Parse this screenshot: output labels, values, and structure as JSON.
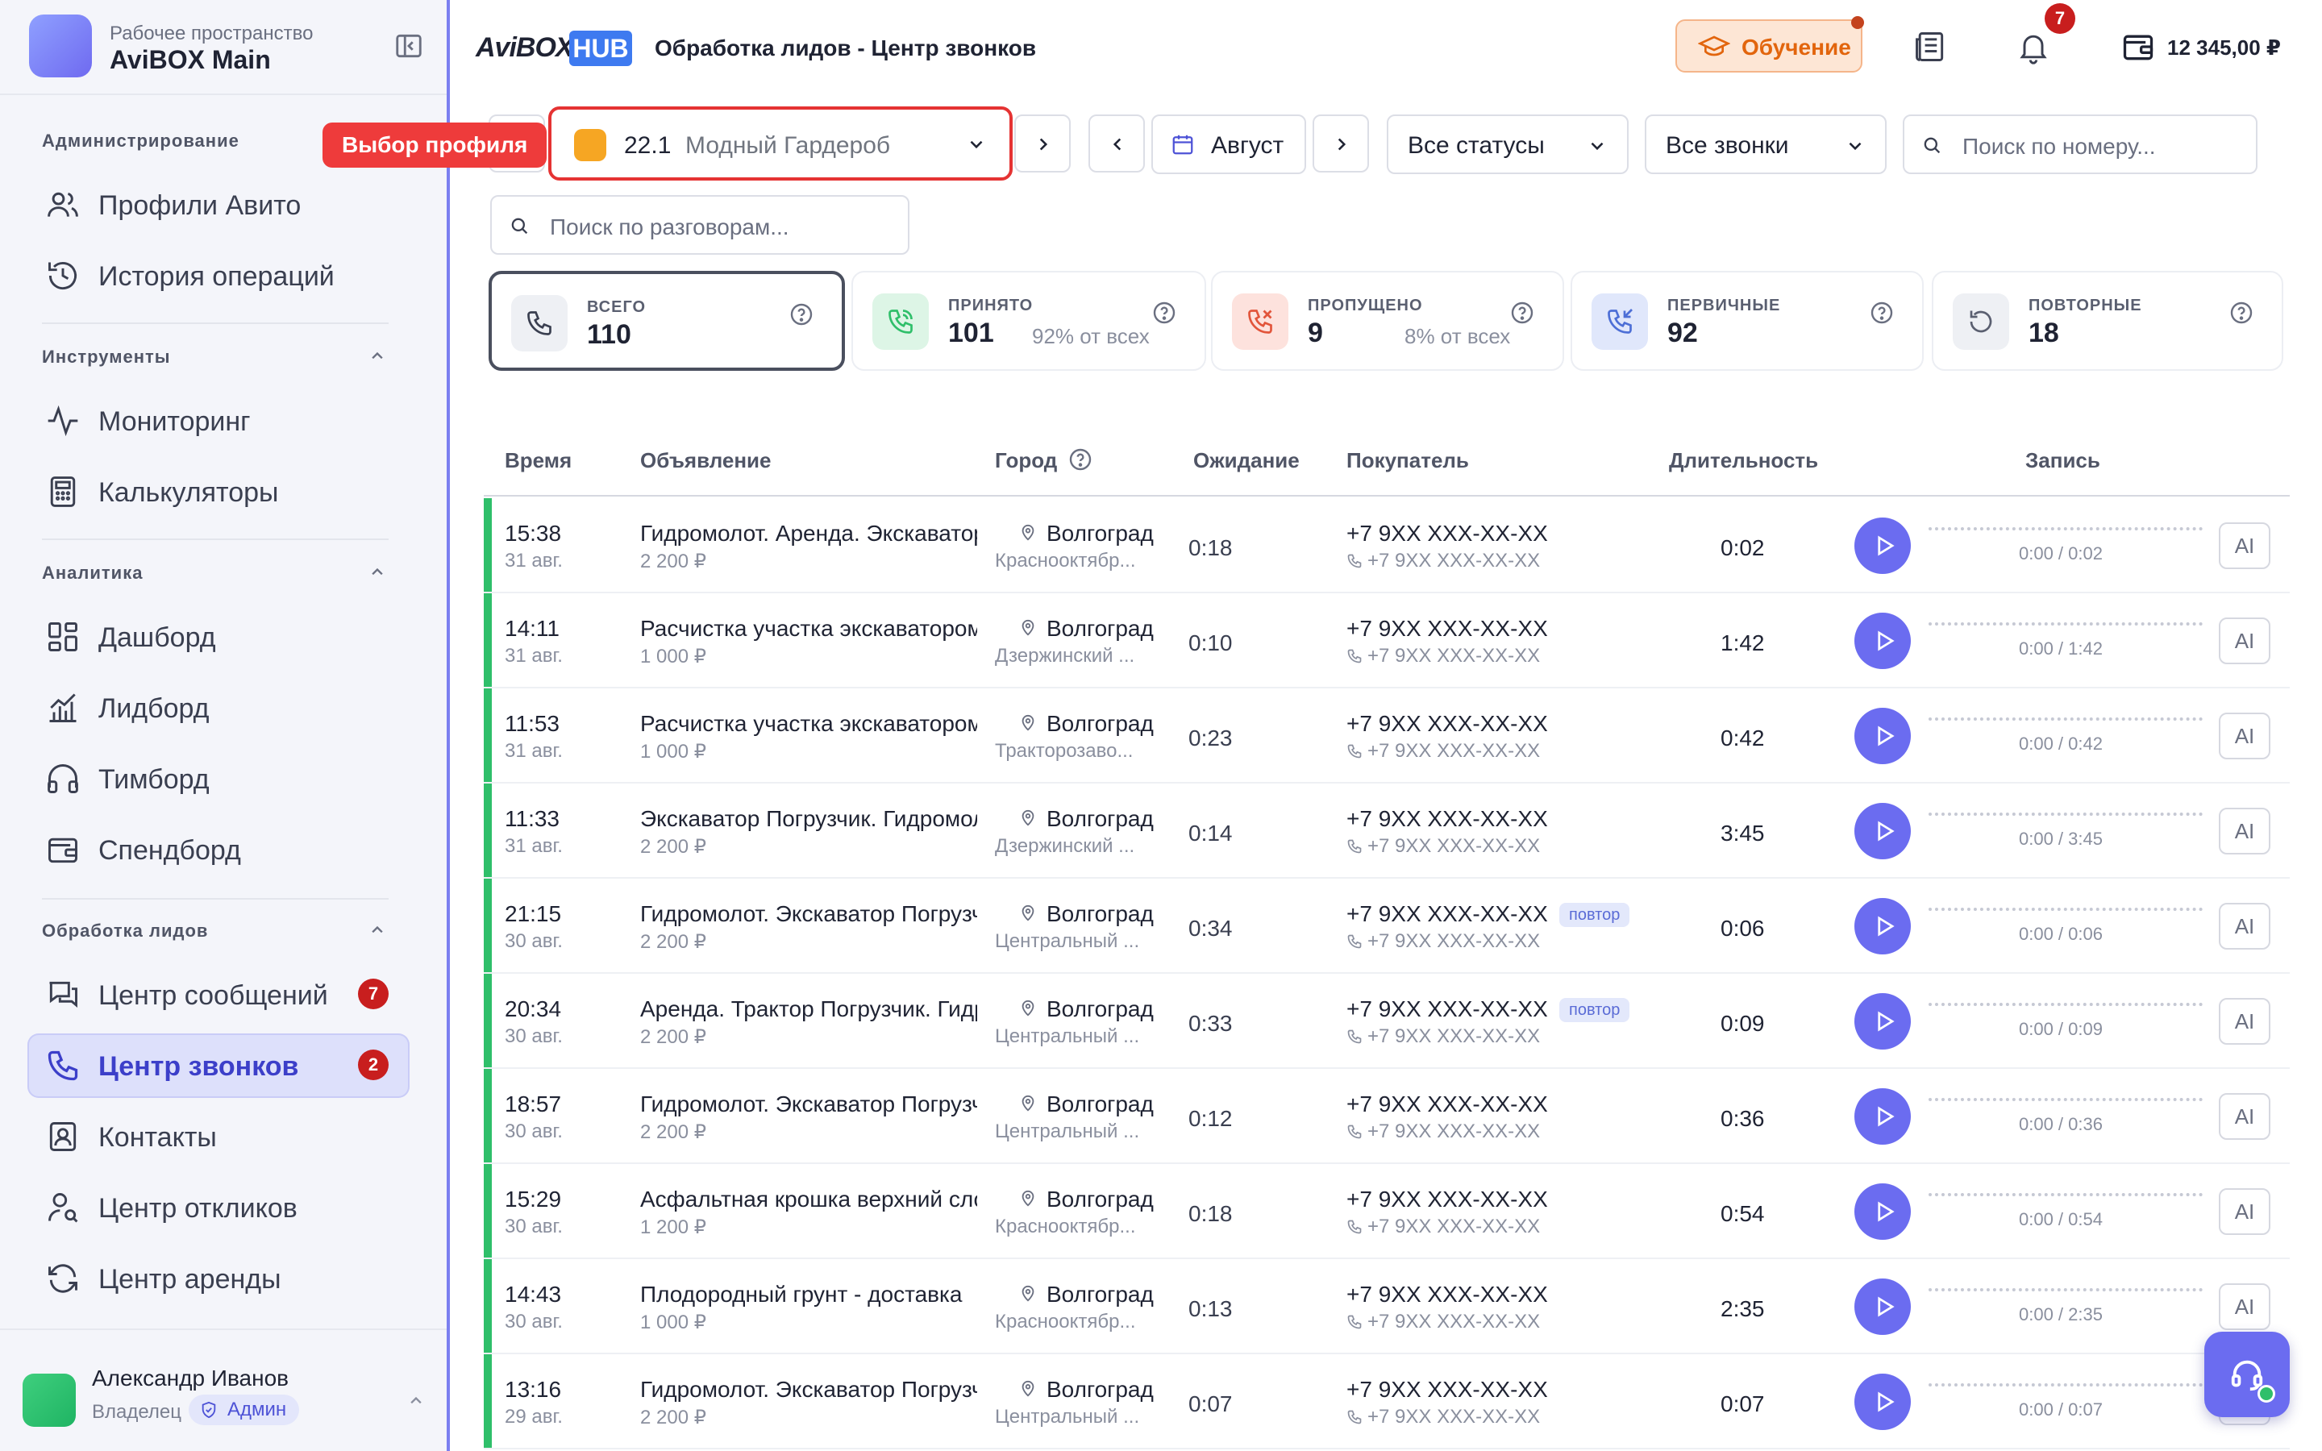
{
  "workspace": {
    "subtitle": "Рабочее пространство",
    "name": "AviBOX Main"
  },
  "brand": {
    "main": "AviBOX",
    "hub": "HUB"
  },
  "header": {
    "page_title": "Обработка лидов - Центр звонков",
    "learn_label": "Обучение",
    "notif_count": "7",
    "balance": "12 345,00 ₽",
    "accent_color": "#6b6cf0"
  },
  "sidebar": {
    "sections": [
      {
        "title": "Администрирование",
        "items": [
          "Профили Авито",
          "История операций"
        ]
      },
      {
        "title": "Инструменты",
        "items": [
          "Мониторинг",
          "Калькуляторы"
        ]
      },
      {
        "title": "Аналитика",
        "items": [
          "Дашборд",
          "Лидборд",
          "Тимборд",
          "Спендборд"
        ]
      },
      {
        "title": "Обработка лидов",
        "items": [
          "Центр сообщений",
          "Центр звонков",
          "Контакты",
          "Центр откликов",
          "Центр аренды"
        ]
      }
    ],
    "badges": {
      "messages": "7",
      "calls": "2"
    }
  },
  "user": {
    "name": "Александр Иванов",
    "role": "Владелец",
    "badge": "Админ"
  },
  "tooltip": "Выбор профиля",
  "filters": {
    "profile_num": "22.1",
    "profile_name": "Модный Гардероб",
    "month": "Август",
    "status": "Все статусы",
    "calls": "Все звонки",
    "search_number_placeholder": "Поиск по номеру...",
    "search_talks_placeholder": "Поиск по разговорам..."
  },
  "stats": [
    {
      "label": "ВСЕГО",
      "value": "110",
      "pct": ""
    },
    {
      "label": "ПРИНЯТО",
      "value": "101",
      "pct": "92% от всех"
    },
    {
      "label": "ПРОПУЩЕНО",
      "value": "9",
      "pct": "8% от всех"
    },
    {
      "label": "ПЕРВИЧНЫЕ",
      "value": "92",
      "pct": ""
    },
    {
      "label": "ПОВТОРНЫЕ",
      "value": "18",
      "pct": ""
    }
  ],
  "table": {
    "columns": [
      "Время",
      "Объявление",
      "Город",
      "Ожидание",
      "Покупатель",
      "Длительность",
      "Запись"
    ],
    "rows": [
      {
        "time": "15:38",
        "date": "31 авг.",
        "ad": "Гидромолот. Аренда. Экскаватор",
        "price": "2 200 ₽",
        "city": "Волгоград",
        "district": "Краснооктябр...",
        "wait": "0:18",
        "buyer": "+7 9XX XXX-XX-XX",
        "buyer2": "+7 9XX XXX-XX-XX",
        "repeat": "",
        "duration": "0:02",
        "playback": "0:00 / 0:02",
        "ai": "AI"
      },
      {
        "time": "14:11",
        "date": "31 авг.",
        "ad": "Расчистка участка экскаватором",
        "price": "1 000 ₽",
        "city": "Волгоград",
        "district": "Дзержинский ...",
        "wait": "0:10",
        "buyer": "+7 9XX XXX-XX-XX",
        "buyer2": "+7 9XX XXX-XX-XX",
        "repeat": "",
        "duration": "1:42",
        "playback": "0:00 / 1:42",
        "ai": "AI"
      },
      {
        "time": "11:53",
        "date": "31 авг.",
        "ad": "Расчистка участка экскаватором",
        "price": "1 000 ₽",
        "city": "Волгоград",
        "district": "Тракторозаво...",
        "wait": "0:23",
        "buyer": "+7 9XX XXX-XX-XX",
        "buyer2": "+7 9XX XXX-XX-XX",
        "repeat": "",
        "duration": "0:42",
        "playback": "0:00 / 0:42",
        "ai": "AI"
      },
      {
        "time": "11:33",
        "date": "31 авг.",
        "ad": "Экскаватор Погрузчик. Гидромолот",
        "price": "2 200 ₽",
        "city": "Волгоград",
        "district": "Дзержинский ...",
        "wait": "0:14",
        "buyer": "+7 9XX XXX-XX-XX",
        "buyer2": "+7 9XX XXX-XX-XX",
        "repeat": "",
        "duration": "3:45",
        "playback": "0:00 / 3:45",
        "ai": "AI"
      },
      {
        "time": "21:15",
        "date": "30 авг.",
        "ad": "Гидромолот. Экскаватор Погрузчик",
        "price": "2 200 ₽",
        "city": "Волгоград",
        "district": "Центральный ...",
        "wait": "0:34",
        "buyer": "+7 9XX XXX-XX-XX",
        "buyer2": "+7 9XX XXX-XX-XX",
        "repeat": "повтор",
        "duration": "0:06",
        "playback": "0:00 / 0:06",
        "ai": "AI"
      },
      {
        "time": "20:34",
        "date": "30 авг.",
        "ad": "Аренда. Трактор Погрузчик. Гидромолот",
        "price": "2 200 ₽",
        "city": "Волгоград",
        "district": "Центральный ...",
        "wait": "0:33",
        "buyer": "+7 9XX XXX-XX-XX",
        "buyer2": "+7 9XX XXX-XX-XX",
        "repeat": "повтор",
        "duration": "0:09",
        "playback": "0:00 / 0:09",
        "ai": "AI"
      },
      {
        "time": "18:57",
        "date": "30 авг.",
        "ad": "Гидромолот. Экскаватор Погрузчик",
        "price": "2 200 ₽",
        "city": "Волгоград",
        "district": "Центральный ...",
        "wait": "0:12",
        "buyer": "+7 9XX XXX-XX-XX",
        "buyer2": "+7 9XX XXX-XX-XX",
        "repeat": "",
        "duration": "0:36",
        "playback": "0:00 / 0:36",
        "ai": "AI"
      },
      {
        "time": "15:29",
        "date": "30 авг.",
        "ad": "Асфальтная крошка верхний слой",
        "price": "1 200 ₽",
        "city": "Волгоград",
        "district": "Краснооктябр...",
        "wait": "0:18",
        "buyer": "+7 9XX XXX-XX-XX",
        "buyer2": "+7 9XX XXX-XX-XX",
        "repeat": "",
        "duration": "0:54",
        "playback": "0:00 / 0:54",
        "ai": "AI"
      },
      {
        "time": "14:43",
        "date": "30 авг.",
        "ad": "Плодородный грунт - доставка",
        "price": "1 000 ₽",
        "city": "Волгоград",
        "district": "Краснооктябр...",
        "wait": "0:13",
        "buyer": "+7 9XX XXX-XX-XX",
        "buyer2": "+7 9XX XXX-XX-XX",
        "repeat": "",
        "duration": "2:35",
        "playback": "0:00 / 2:35",
        "ai": "AI"
      },
      {
        "time": "13:16",
        "date": "29 авг.",
        "ad": "Гидромолот. Экскаватор Погрузчик",
        "price": "2 200 ₽",
        "city": "Волгоград",
        "district": "Центральный ...",
        "wait": "0:07",
        "buyer": "+7 9XX XXX-XX-XX",
        "buyer2": "+7 9XX XXX-XX-XX",
        "repeat": "",
        "duration": "0:07",
        "playback": "0:00 / 0:07",
        "ai": "AI"
      }
    ]
  }
}
